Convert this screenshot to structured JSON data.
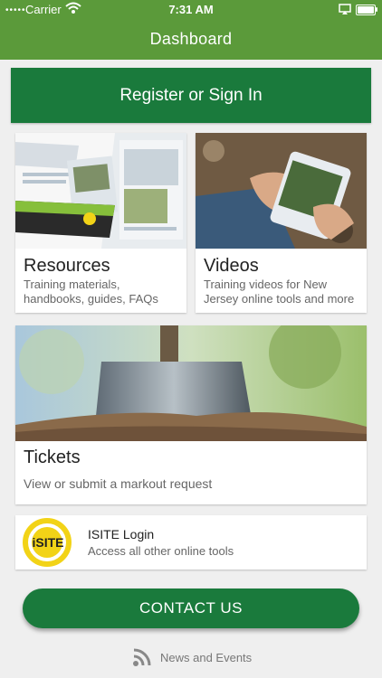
{
  "status_bar": {
    "dots": "•••••",
    "carrier": "Carrier",
    "time": "7:31 AM"
  },
  "header": {
    "title": "Dashboard"
  },
  "register": {
    "label": "Register or Sign In"
  },
  "cards": {
    "resources": {
      "title": "Resources",
      "subtitle": "Training materials, handbooks, guides, FAQs"
    },
    "videos": {
      "title": "Videos",
      "subtitle": "Training videos for New Jersey online tools and more"
    },
    "tickets": {
      "title": "Tickets",
      "subtitle": "View or submit a markout request"
    },
    "isite": {
      "title": "ISITE Login",
      "subtitle": "Access all other online tools",
      "logo_text": "iSITE"
    }
  },
  "contact": {
    "label": "CONTACT US"
  },
  "news": {
    "label": "News and Events"
  },
  "colors": {
    "header_green": "#5b9a3a",
    "button_green": "#1a7a3c",
    "logo_yellow": "#f2d317"
  }
}
